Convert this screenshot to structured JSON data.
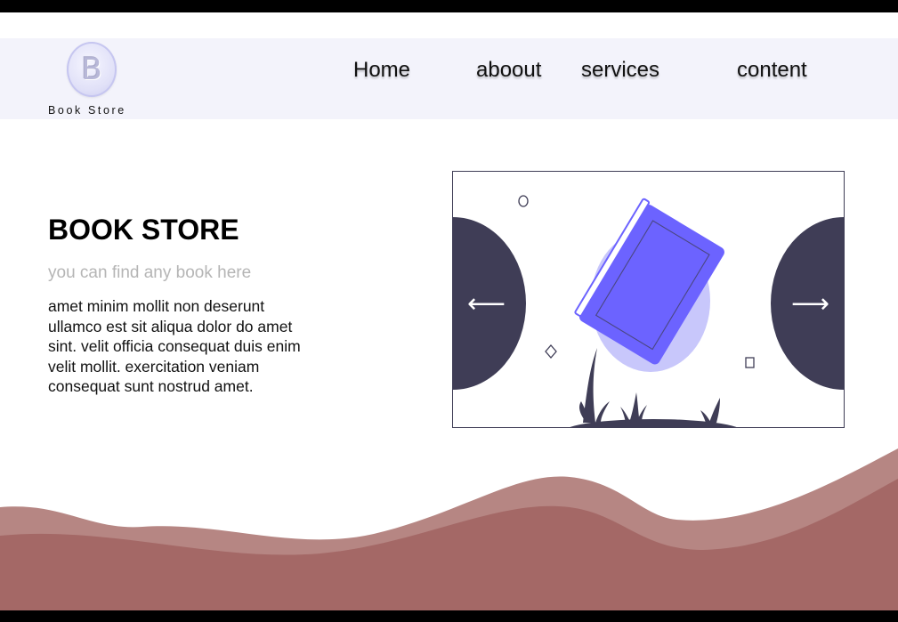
{
  "logo": {
    "letter": "B",
    "text": "Book Store"
  },
  "nav": {
    "items": [
      "Home",
      "aboout",
      "services",
      "content"
    ]
  },
  "hero": {
    "title": "BOOK STORE",
    "subtitle": "you can find any book here",
    "body": "amet minim mollit non deserunt ullamco est sit aliqua dolor do amet sint. velit officia consequat duis enim velit mollit. exercitation veniam consequat sunt nostrud amet."
  },
  "slider": {
    "prev_icon": "left-arrow-icon",
    "next_icon": "right-arrow-icon",
    "prev_glyph": "⟵",
    "next_glyph": "⟶"
  },
  "colors": {
    "header_bg": "#f3f3fb",
    "accent_purple": "#6c63ff",
    "dark_navy": "#3f3d56",
    "wave_light": "#b68683",
    "wave_dark": "#a46866"
  }
}
